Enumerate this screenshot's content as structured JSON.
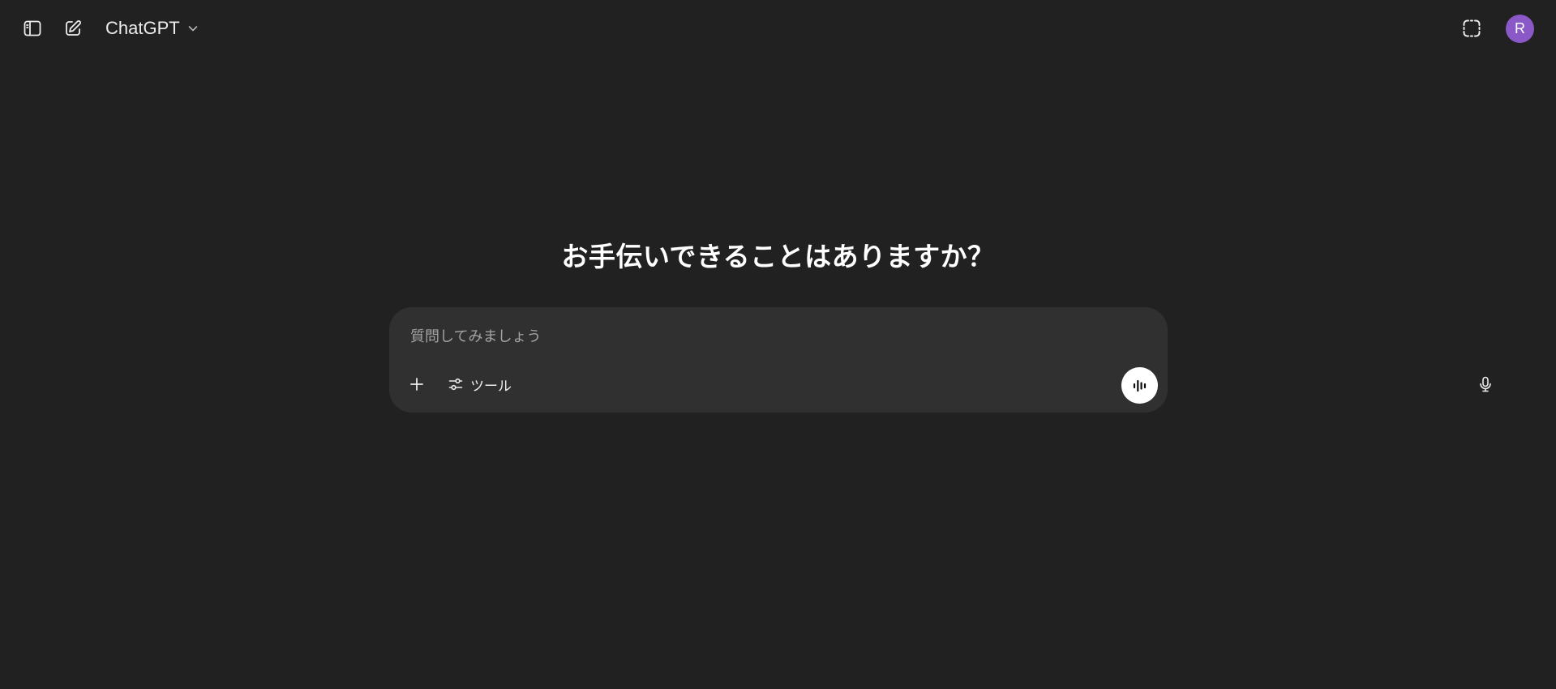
{
  "header": {
    "model_name": "ChatGPT",
    "avatar_initial": "R",
    "avatar_color": "#8a58c7",
    "icons": [
      "sidebar-toggle-icon",
      "new-chat-icon",
      "chevron-down-icon",
      "temporary-chat-icon"
    ]
  },
  "main": {
    "title": "お手伝いできることはありますか？"
  },
  "composer": {
    "placeholder": "質問してみましょう",
    "value": "",
    "tools_label": "ツール",
    "icons": [
      "plus-icon",
      "sliders-icon",
      "microphone-icon",
      "voice-waveform-icon"
    ]
  },
  "colors": {
    "background": "#212121",
    "composer_bg": "#303030",
    "text": "#ececec",
    "placeholder": "#a3a3a3"
  }
}
